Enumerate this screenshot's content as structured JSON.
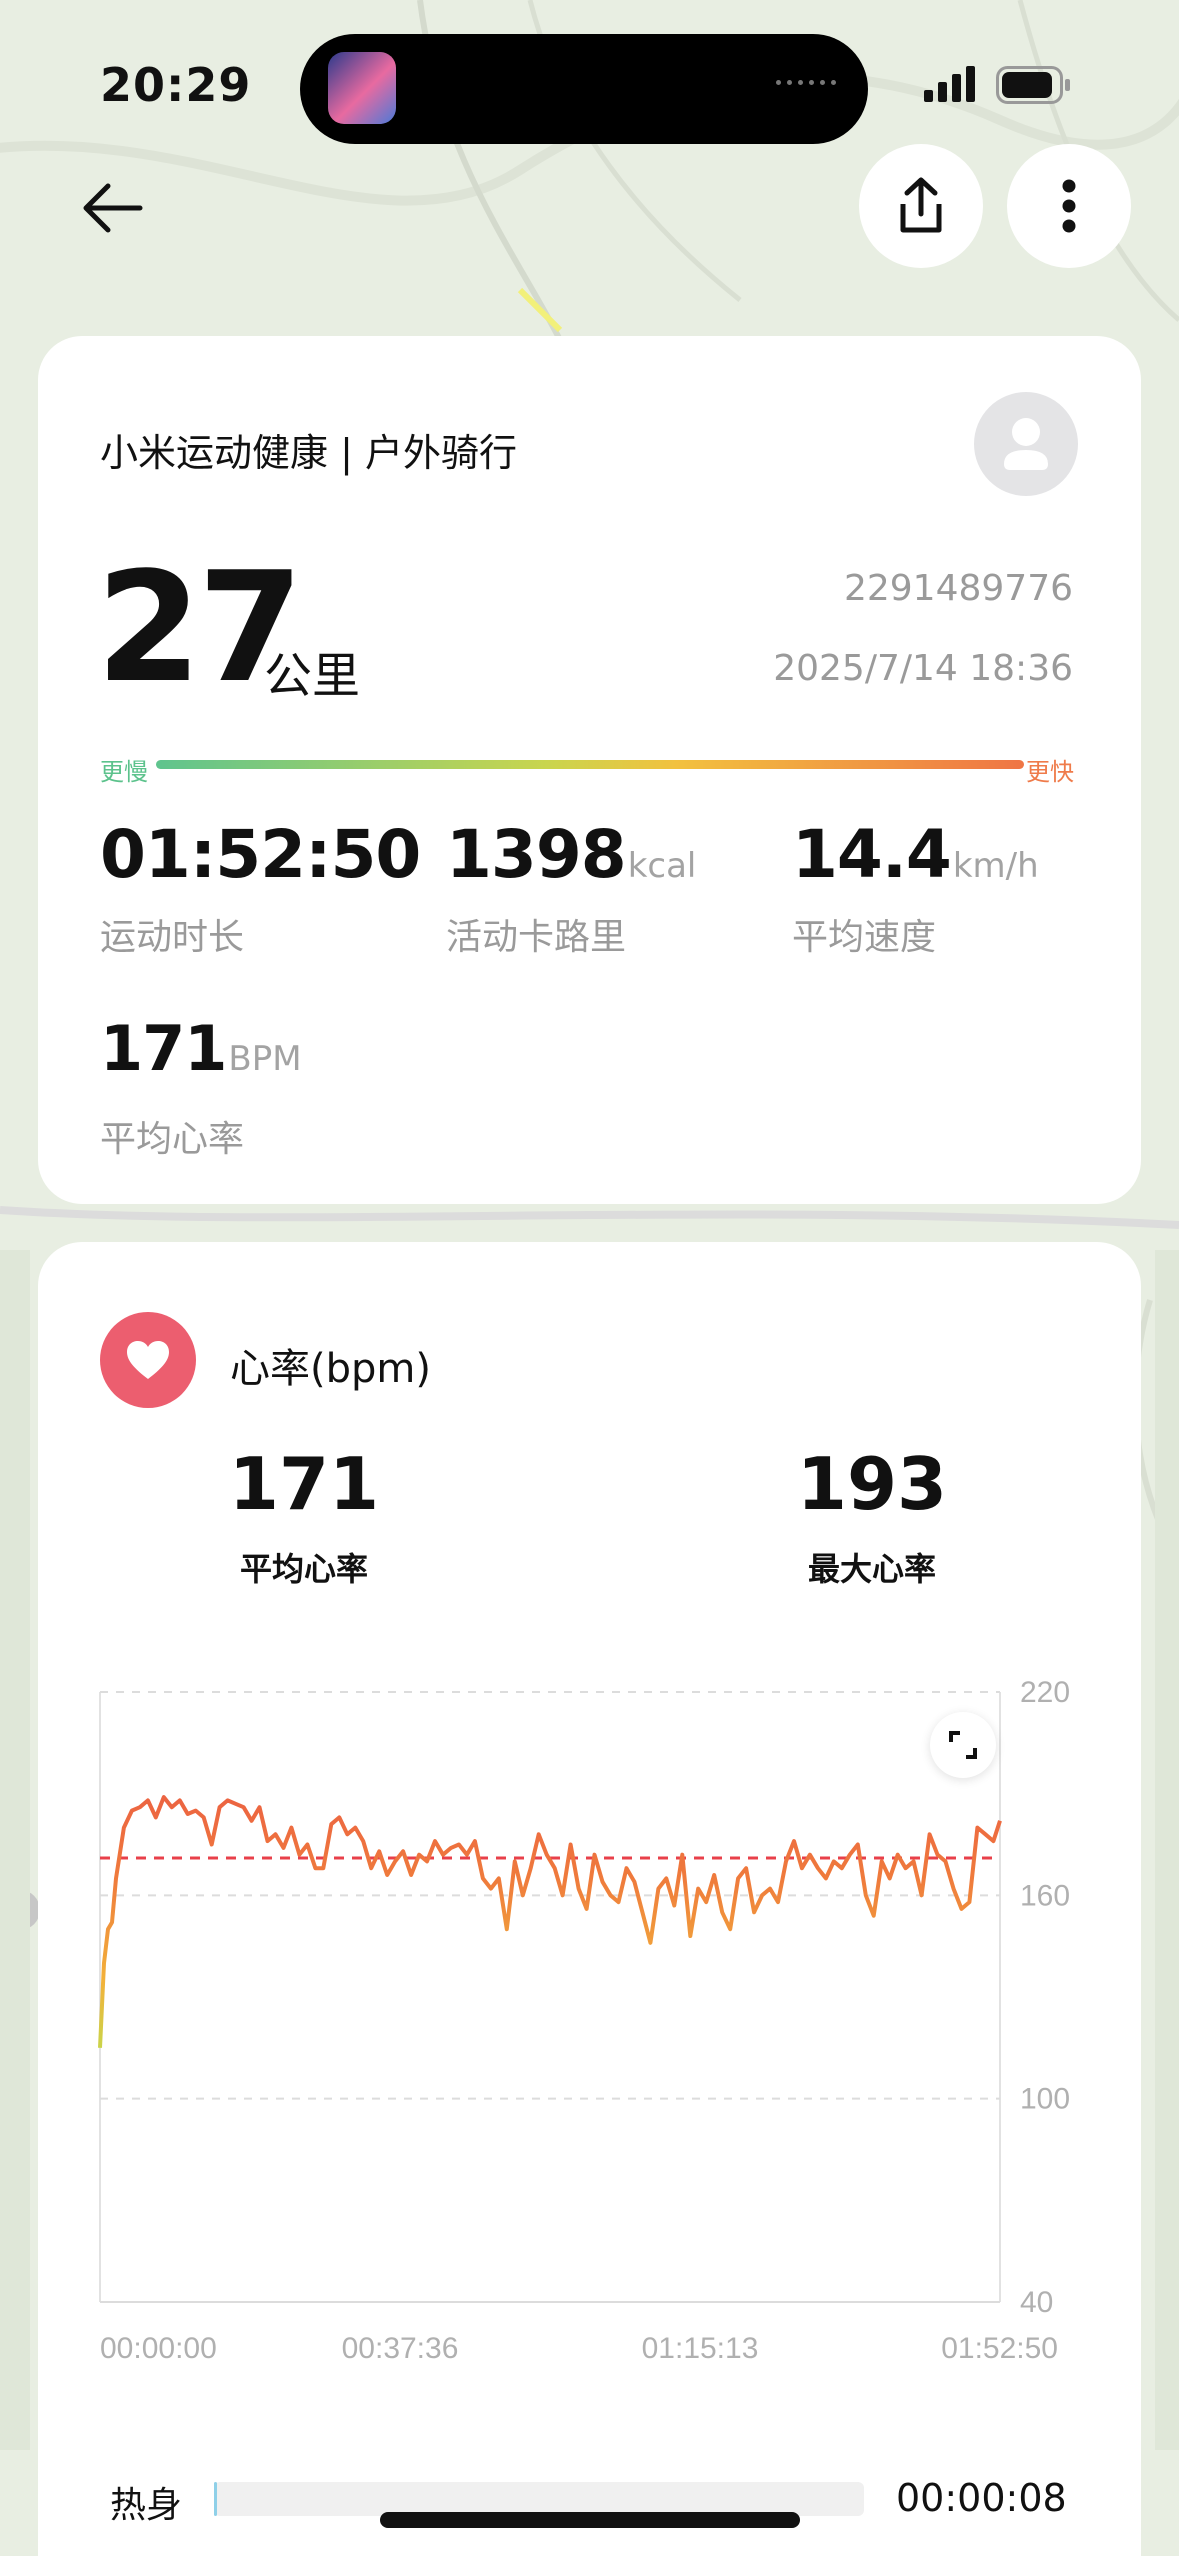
{
  "status_bar": {
    "time": "20:29"
  },
  "record": {
    "source_title": "小米运动健康 | 户外骑行",
    "distance_value": "27",
    "distance_unit": "公里",
    "record_id": "2291489776",
    "date": "2025/7/14 18:36",
    "slow_label": "更慢",
    "fast_label": "更快"
  },
  "stats": [
    {
      "value": "01:52:50",
      "unit": "",
      "label": "运动时长"
    },
    {
      "value": "1398",
      "unit": "kcal",
      "label": "活动卡路里"
    },
    {
      "value": "14.4",
      "unit": "km/h",
      "label": "平均速度"
    },
    {
      "value": "171",
      "unit": "BPM",
      "label": "平均心率"
    }
  ],
  "heart_rate": {
    "title": "心率(bpm)",
    "avg_value": "171",
    "avg_label": "平均心率",
    "max_value": "193",
    "max_label": "最大心率"
  },
  "chart_data": {
    "type": "line",
    "x_tick_labels": [
      "00:00:00",
      "00:37:36",
      "01:15:13",
      "01:52:50"
    ],
    "y_tick_labels": [
      "220",
      "160",
      "100",
      "40"
    ],
    "ylim": [
      40,
      220
    ],
    "x_range_minutes": [
      0,
      112.83
    ],
    "reference_line": 171,
    "grid": true,
    "x": [
      0,
      0.5,
      1,
      1.5,
      2,
      3,
      4,
      5,
      6,
      7,
      8,
      9,
      10,
      11,
      12,
      13,
      14,
      15,
      16,
      17,
      18,
      19,
      20,
      21,
      22,
      23,
      24,
      25,
      26,
      27,
      28,
      29,
      30,
      31,
      32,
      33,
      34,
      35,
      36,
      37,
      38,
      39,
      40,
      41,
      42,
      43,
      44,
      45,
      46,
      47,
      48,
      49,
      50,
      51,
      52,
      53,
      54,
      55,
      56,
      57,
      58,
      59,
      60,
      61,
      62,
      63,
      64,
      65,
      66,
      67,
      68,
      69,
      70,
      71,
      72,
      73,
      74,
      75,
      76,
      77,
      78,
      79,
      80,
      81,
      82,
      83,
      84,
      85,
      86,
      87,
      88,
      89,
      90,
      91,
      92,
      93,
      94,
      95,
      96,
      97,
      98,
      99,
      100,
      101,
      102,
      103,
      104,
      105,
      106,
      107,
      108,
      109,
      110,
      111,
      112,
      112.83
    ],
    "y": [
      115,
      140,
      150,
      152,
      165,
      180,
      185,
      186,
      188,
      183,
      189,
      186,
      188,
      184,
      185,
      183,
      175,
      186,
      188,
      187,
      186,
      182,
      186,
      176,
      178,
      174,
      180,
      172,
      175,
      168,
      168,
      181,
      183,
      178,
      180,
      176,
      168,
      173,
      166,
      170,
      173,
      166,
      172,
      170,
      176,
      172,
      174,
      175,
      172,
      176,
      165,
      162,
      165,
      150,
      170,
      160,
      168,
      178,
      172,
      168,
      160,
      175,
      162,
      156,
      172,
      164,
      160,
      158,
      168,
      164,
      155,
      146,
      162,
      165,
      157,
      172,
      148,
      162,
      158,
      166,
      155,
      150,
      165,
      168,
      155,
      160,
      162,
      158,
      170,
      176,
      168,
      172,
      168,
      165,
      170,
      168,
      172,
      175,
      160,
      154,
      170,
      165,
      172,
      168,
      170,
      160,
      178,
      172,
      170,
      162,
      156,
      158,
      180,
      178,
      176,
      182
    ],
    "series": [
      {
        "values_in_y": true
      }
    ]
  },
  "zones": [
    {
      "label": "热身",
      "time": "00:00:08",
      "fraction": 0.004
    }
  ]
}
